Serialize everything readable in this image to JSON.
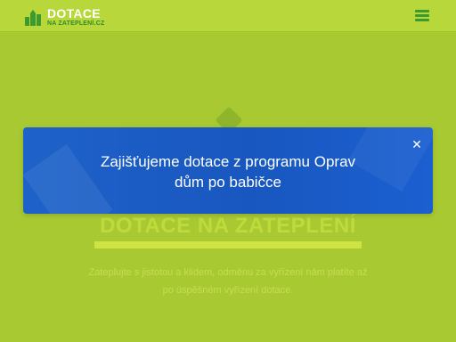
{
  "header": {
    "logo_title": "DOTACE",
    "logo_subtitle": "NA ZATEPLENÍ.CZ",
    "menu_icon": "hamburger-menu-icon"
  },
  "hero": {
    "title": "DOTACE NA ZATEPLENÍ",
    "text": "Zateplujte s jistotou a klidem, odměnu za vyřízení nám platíte až po úspěšném vyřízení dotace."
  },
  "modal": {
    "message_line1": "Zajišťujeme dotace z programu Oprav",
    "message_line2": "dům po babičce",
    "close_icon": "close-icon"
  },
  "colors": {
    "page_green": "#a9c932",
    "header_green": "#b7d73a",
    "brand_dark_green": "#3c9a2e",
    "modal_blue": "#1a5cc8"
  }
}
